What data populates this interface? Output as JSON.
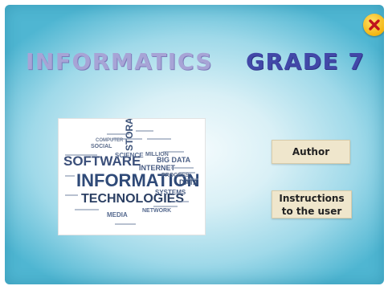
{
  "header": {
    "title_left": "INFORMATICS",
    "title_right": "GRADE 7"
  },
  "close_button": {
    "icon": "close-icon",
    "color": "#c0141c"
  },
  "cloud": {
    "words": [
      "SOFTWARE",
      "INFORMATION",
      "TECHNOLOGIES",
      "STORAGE",
      "BIG DATA",
      "SCIENCE",
      "INTERNET",
      "SOCIAL",
      "MILLION",
      "PROCESS",
      "SYSTEMS",
      "DATA",
      "MEDIA",
      "COMPUTER",
      "NETWORK"
    ]
  },
  "buttons": {
    "author": "Author",
    "instructions": "Instructions\nto the user"
  },
  "colors": {
    "title_left": "#a7a4d6",
    "title_right": "#4248a8",
    "button_bg": "#efe6cc",
    "background_edge": "#4fb6d2"
  }
}
